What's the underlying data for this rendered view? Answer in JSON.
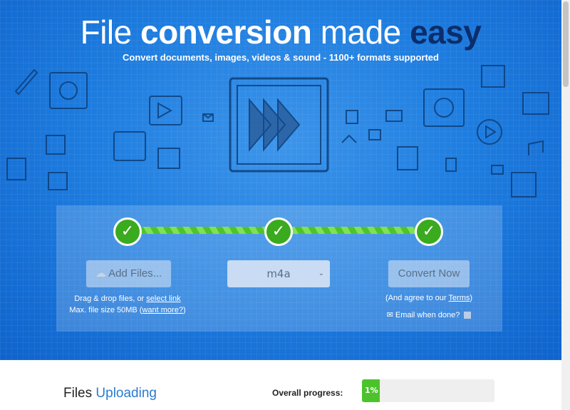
{
  "hero": {
    "title_part1": "File ",
    "title_part2": "conversion",
    "title_part3": " made ",
    "title_part4": "easy",
    "subtitle": "Convert documents, images, videos & sound - 1100+ formats supported"
  },
  "steps": {
    "add_files_label": "Add Files...",
    "drag_text": "Drag & drop files, or ",
    "select_link": "select link",
    "max_text": "Max. file size 50MB (",
    "want_more": "want more?",
    "max_close": ")",
    "format_selected": "m4a",
    "convert_label": "Convert Now",
    "agree_text": "(And agree to our ",
    "terms_link": "Terms",
    "agree_close": ")",
    "email_label": "Email when done?",
    "check_glyph": "✓"
  },
  "upload": {
    "title1": "Files ",
    "title2": "Uploading",
    "overall_label": "Overall progress:",
    "progress_percent": 1,
    "progress_text": "1%"
  },
  "colors": {
    "accent": "#2a7bd0",
    "progress": "#4cc32c",
    "title_dark": "#0b2e6b"
  }
}
